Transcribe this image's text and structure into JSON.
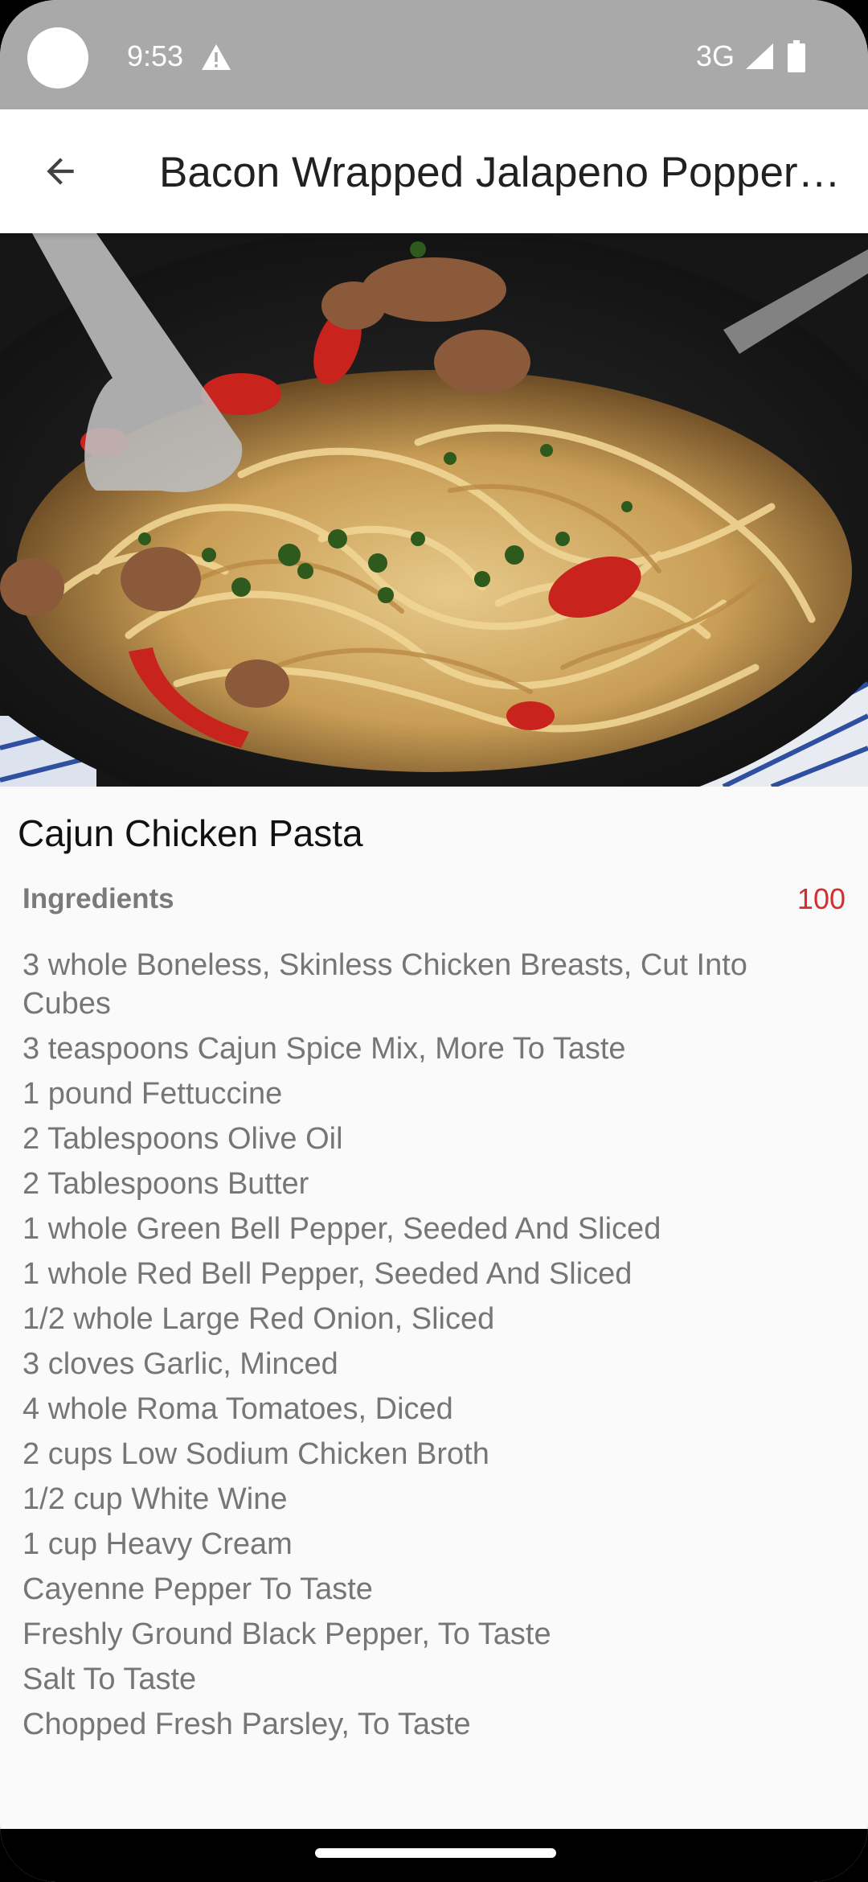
{
  "status_bar": {
    "time": "9:53",
    "network": "3G",
    "icons": [
      "warning-icon",
      "signal-icon",
      "battery-icon"
    ]
  },
  "app_bar": {
    "back_icon": "arrow-back-icon",
    "title": "Bacon Wrapped Jalapeno Popper Stuffed Chicken"
  },
  "hero_image": {
    "subject": "cajun-chicken-pasta-photo"
  },
  "recipe": {
    "name": "Cajun Chicken Pasta",
    "ingredients_label": "Ingredients",
    "ingredients_count": "100",
    "ingredients": [
      "3 whole Boneless, Skinless Chicken Breasts, Cut Into Cubes",
      "3 teaspoons Cajun Spice Mix, More To Taste",
      "1 pound Fettuccine",
      "2 Tablespoons Olive Oil",
      "2 Tablespoons Butter",
      "1 whole Green Bell Pepper, Seeded And Sliced",
      "1 whole Red Bell Pepper, Seeded And Sliced",
      "1/2 whole Large Red Onion, Sliced",
      "3 cloves Garlic, Minced",
      "4 whole Roma Tomatoes, Diced",
      "2 cups Low Sodium Chicken Broth",
      "1/2 cup White Wine",
      "1 cup Heavy Cream",
      "Cayenne Pepper To Taste",
      "Freshly Ground Black Pepper, To Taste",
      "Salt To Taste",
      "Chopped Fresh Parsley, To Taste"
    ]
  },
  "colors": {
    "status_bar": "#a9a9a9",
    "accent_count": "#d32f2f",
    "ingredient_text": "#767676",
    "background": "#fafafa"
  }
}
